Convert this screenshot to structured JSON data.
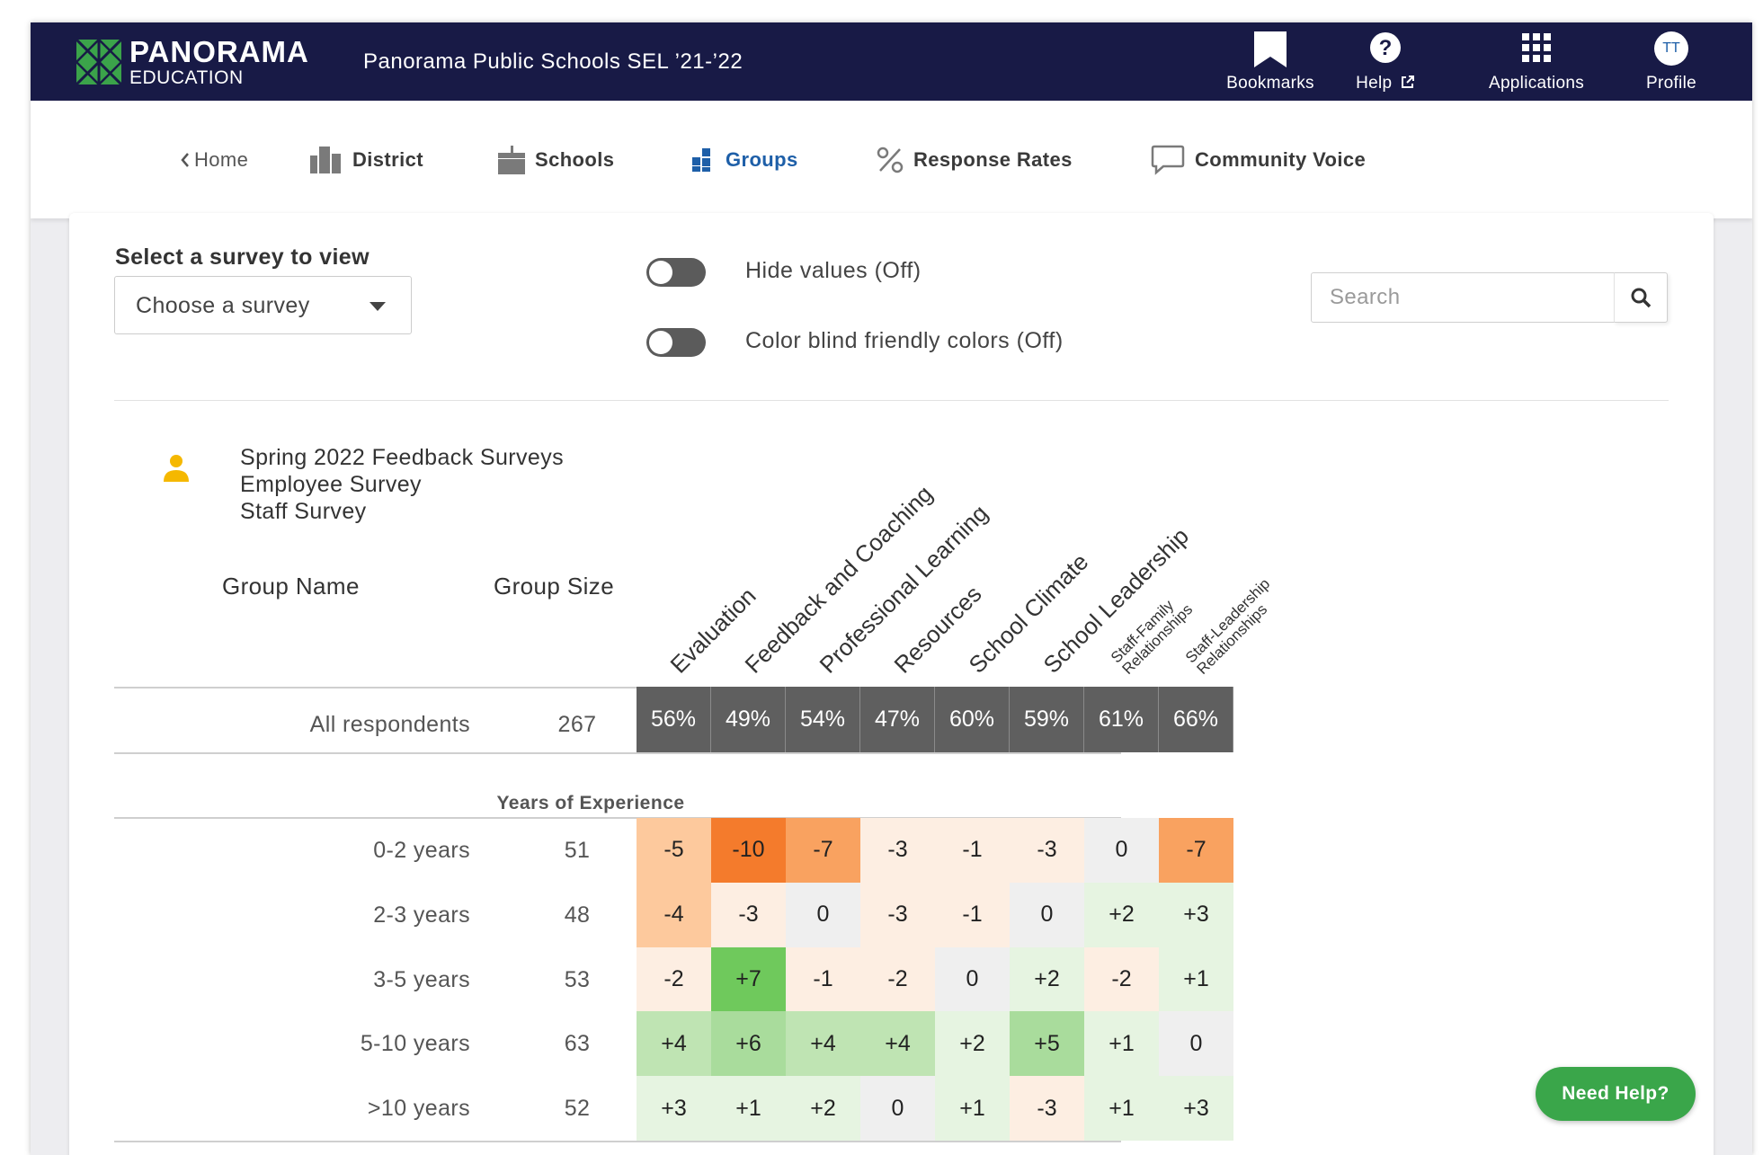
{
  "brand": {
    "name": "PANORAMA",
    "sub": "EDUCATION",
    "logo_color": "#3ba34a"
  },
  "app_title": "Panorama Public Schools SEL ’21-’22",
  "topbar": {
    "background": "#181a46",
    "items": [
      {
        "label": "Bookmarks",
        "icon": "bookmark-icon"
      },
      {
        "label": "Help",
        "icon": "help-icon"
      },
      {
        "label": "Applications",
        "icon": "grid-icon"
      },
      {
        "label": "Profile",
        "icon": "avatar",
        "initials": "TT"
      }
    ]
  },
  "nav": {
    "active_color": "#1e5fa8",
    "items": [
      {
        "label": "Home",
        "icon": "chevron-left-icon"
      },
      {
        "label": "District",
        "icon": "building-icon"
      },
      {
        "label": "Schools",
        "icon": "school-icon"
      },
      {
        "label": "Groups",
        "icon": "groups-icon",
        "active": true
      },
      {
        "label": "Response Rates",
        "icon": "percent-icon"
      },
      {
        "label": "Community Voice",
        "icon": "speech-bubble-icon"
      }
    ]
  },
  "controls": {
    "survey_label": "Select a survey to view",
    "survey_value": "Choose a survey",
    "toggles": [
      {
        "label": "Hide values (Off)",
        "on": false
      },
      {
        "label": "Color blind friendly colors (Off)",
        "on": false
      }
    ],
    "search_placeholder": "Search"
  },
  "survey_info": {
    "lines": [
      "Spring 2022 Feedback Surveys",
      "Employee Survey",
      "Staff Survey"
    ],
    "icon_color": "#f5b800"
  },
  "table": {
    "col_group_name": "Group Name",
    "col_group_size": "Group Size",
    "topics": [
      [
        "Evaluation"
      ],
      [
        "Feedback and Coaching"
      ],
      [
        "Professional Learning"
      ],
      [
        "Resources"
      ],
      [
        "School Climate"
      ],
      [
        "School Leadership"
      ],
      [
        "Staff-Family",
        "Relationships"
      ],
      [
        "Staff-Leadership",
        "Relationships"
      ]
    ],
    "all_respondents": {
      "label": "All respondents",
      "size": "267",
      "values": [
        "56%",
        "49%",
        "54%",
        "47%",
        "60%",
        "59%",
        "61%",
        "66%"
      ]
    },
    "section": "Years of Experience",
    "rows": [
      {
        "label": "0-2 years",
        "size": "51",
        "values": [
          "-5",
          "-10",
          "-7",
          "-3",
          "-1",
          "-3",
          "0",
          "-7"
        ]
      },
      {
        "label": "2-3 years",
        "size": "48",
        "values": [
          "-4",
          "-3",
          "0",
          "-3",
          "-1",
          "0",
          "+2",
          "+3"
        ]
      },
      {
        "label": "3-5 years",
        "size": "53",
        "values": [
          "-2",
          "+7",
          "-1",
          "-2",
          "0",
          "+2",
          "-2",
          "+1"
        ]
      },
      {
        "label": "5-10 years",
        "size": "63",
        "values": [
          "+4",
          "+6",
          "+4",
          "+4",
          "+2",
          "+5",
          "+1",
          "0"
        ]
      },
      {
        "label": ">10 years",
        "size": "52",
        "values": [
          "+3",
          "+1",
          "+2",
          "0",
          "+1",
          "-3",
          "+1",
          "+3"
        ]
      }
    ],
    "scale_colors": {
      "neg_strong": "#f47b2c",
      "neg_mid": "#f9a260",
      "neg_light": "#fdc99d",
      "neg_faint": "#fdeee2",
      "zero": "#efefef",
      "pos_faint": "#e6f4e1",
      "pos_light": "#bfe4b3",
      "pos_mid": "#a9dc9c",
      "pos_strong": "#6fc95c"
    }
  },
  "need_help": "Need Help?"
}
